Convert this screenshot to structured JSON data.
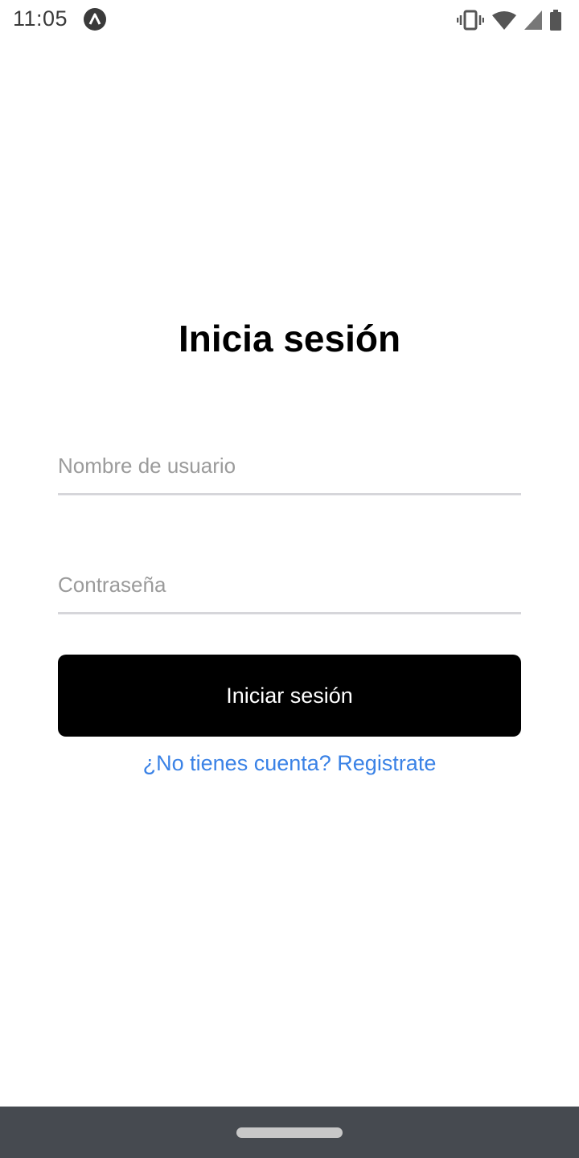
{
  "status_bar": {
    "time": "11:05",
    "app_icon": "expo-app-icon",
    "icons": [
      "vibrate-icon",
      "wifi-icon",
      "cell-signal-icon",
      "battery-icon"
    ]
  },
  "login": {
    "title": "Inicia sesión",
    "username_placeholder": "Nombre de usuario",
    "username_value": "",
    "password_placeholder": "Contraseña",
    "password_value": "",
    "submit_label": "Iniciar sesión",
    "register_link": "¿No tienes cuenta? Registrate"
  },
  "colors": {
    "button_bg": "#000000",
    "link": "#3a82e6",
    "nav_bar": "#464a50"
  }
}
